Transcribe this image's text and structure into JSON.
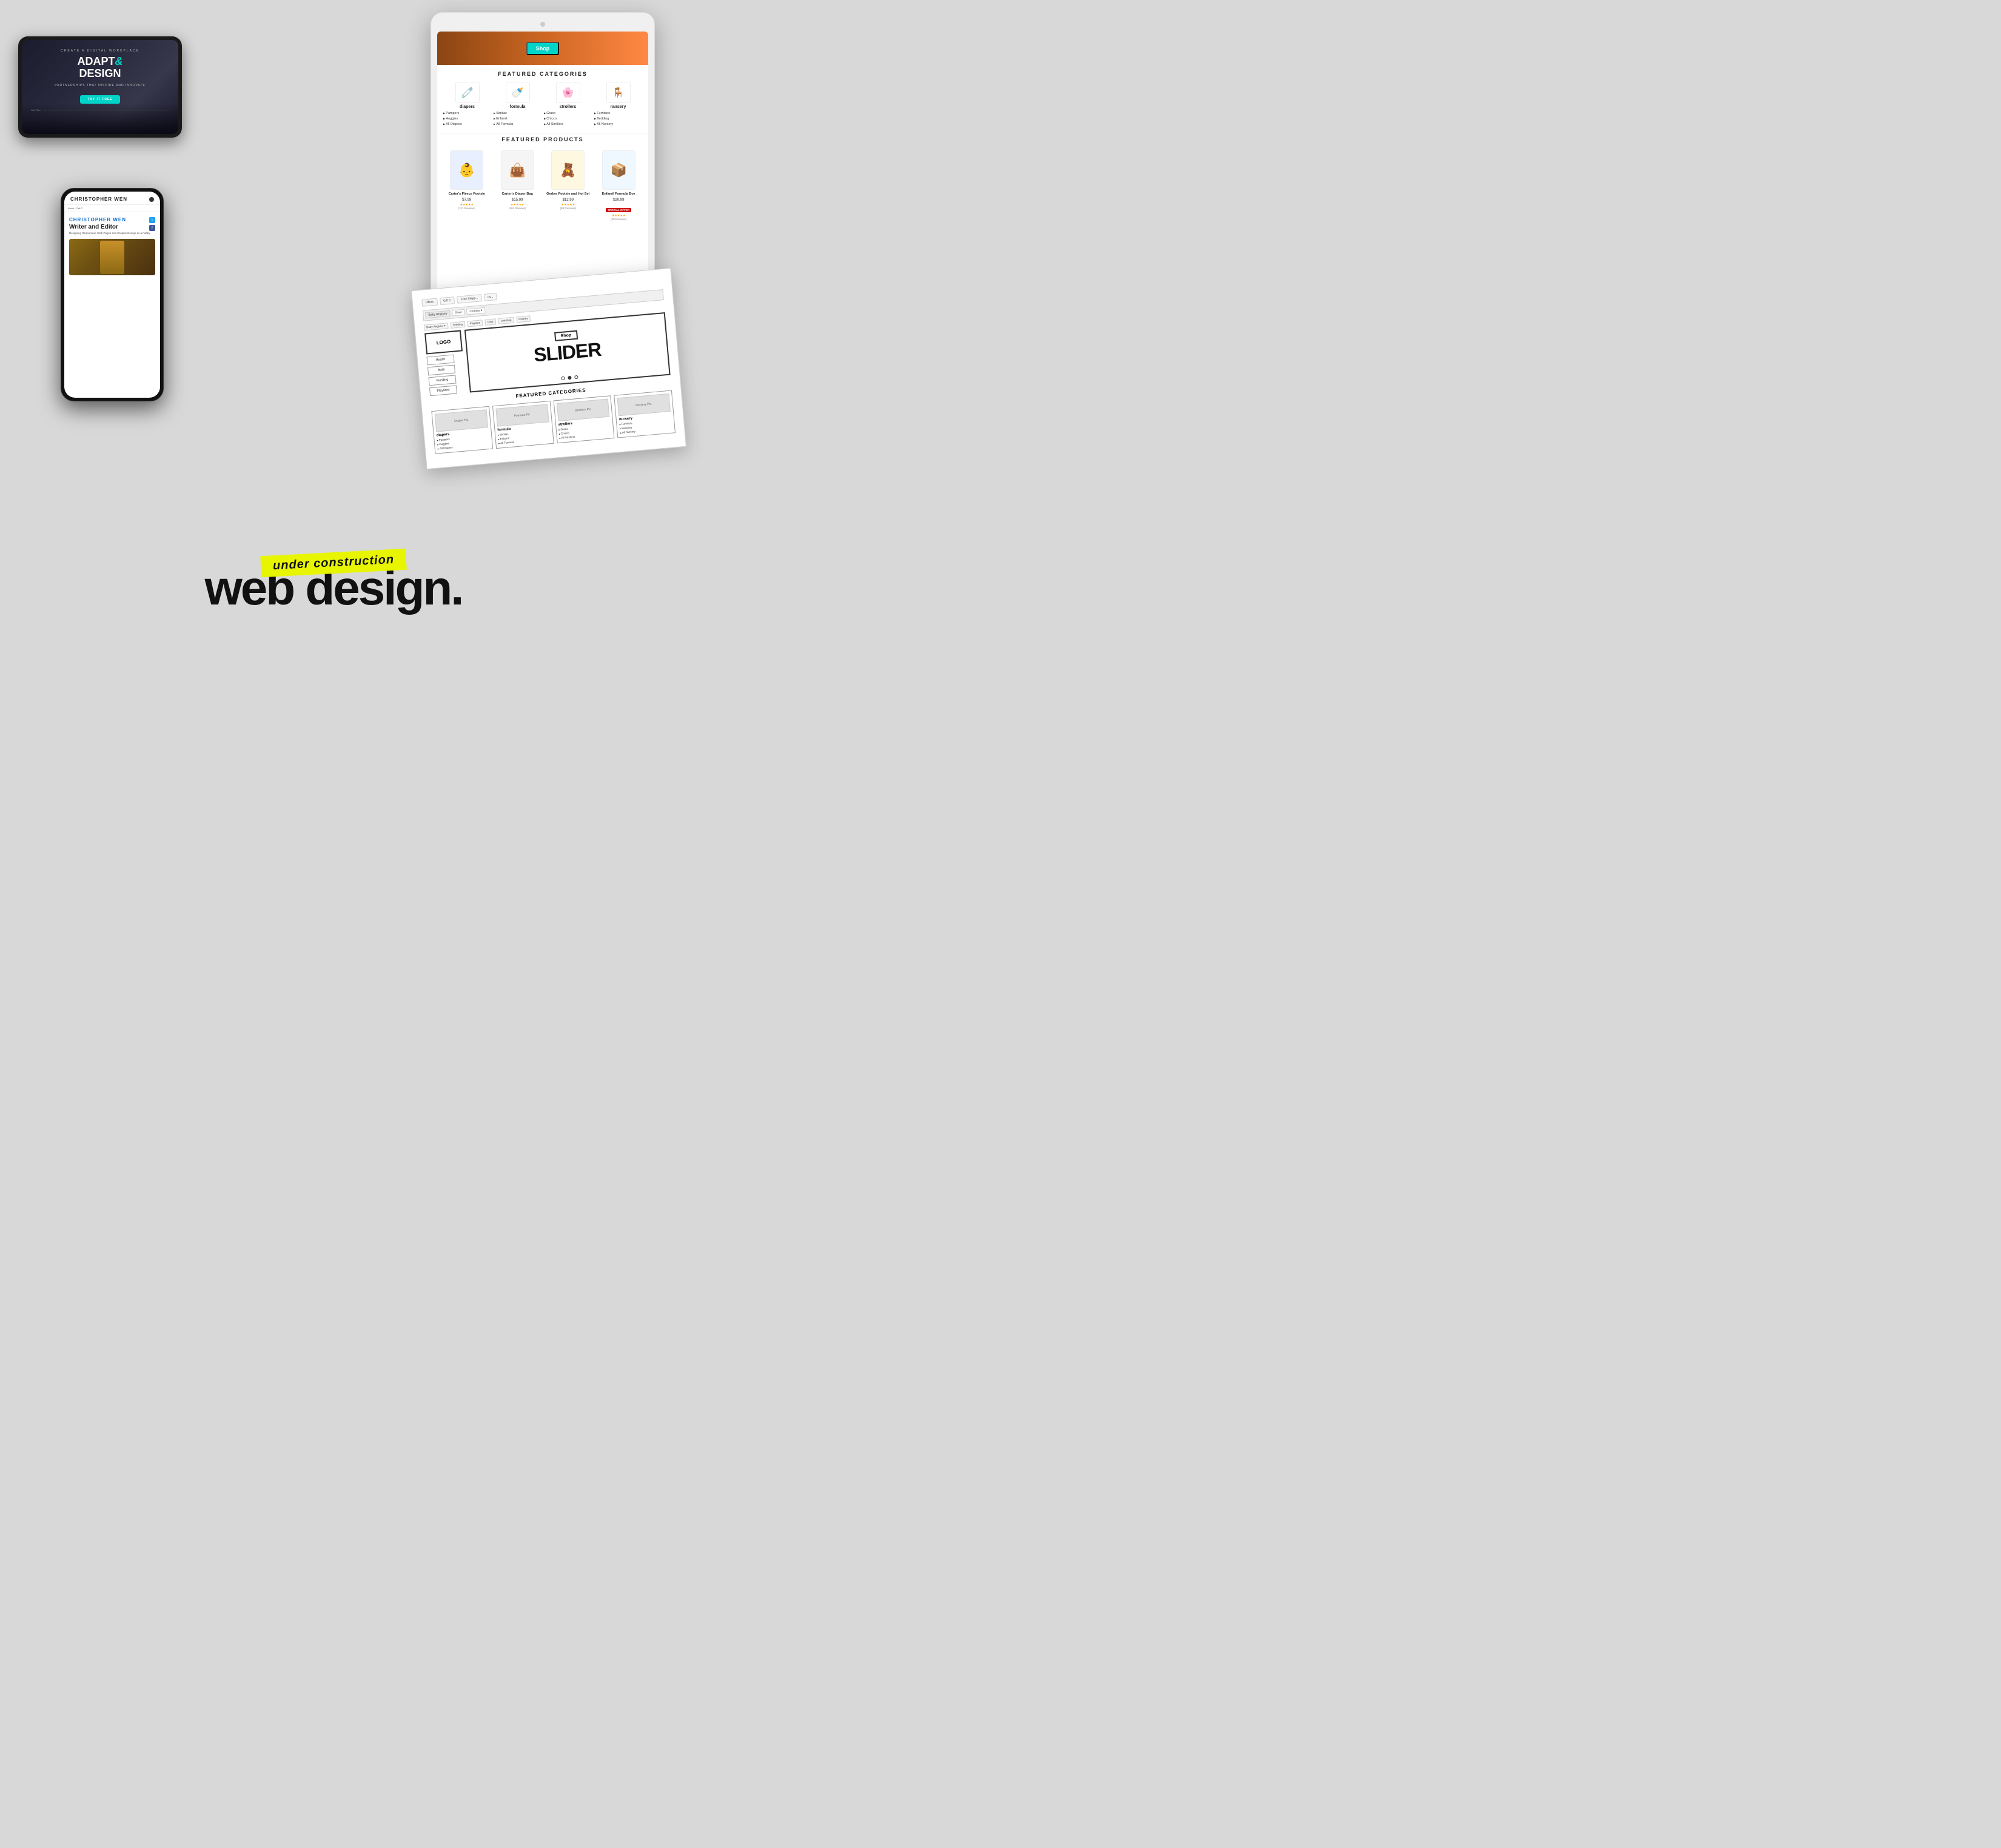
{
  "page": {
    "background": "#d8d8d8"
  },
  "adapt_device": {
    "subtitle": "CREATE A DIGITAL WORKPLACE",
    "title_line1": "ADAPT",
    "title_ampersand": "&",
    "title_line2": "DESIGN",
    "tagline": "PARTNERSHIPS THAT INSPIRE AND INNOVATE",
    "button": "TRY IT FREE",
    "footer_brand": "LiveTiles"
  },
  "christopher_device": {
    "header_name": "Christopher Wen",
    "nav_items": [
      "About",
      "Call C"
    ],
    "name_big": "CHRISTOPHER WEN",
    "title": "Writer and Editor",
    "description": "Designing Responsive Web Pages and Graphic Design as a hobby.",
    "social": [
      "Twitter",
      "Facebook"
    ]
  },
  "tablet": {
    "shop_button": "Shop",
    "featured_categories_title": "FEATURED CATEGORIES",
    "featured_products_title": "FEATURED PRODUCTS",
    "categories": [
      {
        "name": "diapers",
        "icon": "🧷",
        "links": [
          "Pampers",
          "Huggies",
          "All Diapers"
        ]
      },
      {
        "name": "formula",
        "icon": "🍼",
        "links": [
          "Similac",
          "Enfamil",
          "All Formula"
        ]
      },
      {
        "name": "strollers",
        "icon": "🌸",
        "links": [
          "Graco",
          "Chicco",
          "All Strollers"
        ]
      },
      {
        "name": "nursery",
        "icon": "🪑",
        "links": [
          "Furniture",
          "Bedding",
          "All Nursery"
        ]
      }
    ],
    "products": [
      {
        "name": "Carter's Fleece Footsie",
        "price": "$7.99",
        "stars": "★★★★★",
        "reviews": "(131 Reviews)",
        "icon": "👶"
      },
      {
        "name": "Carter's Diaper Bag",
        "price": "$15.99",
        "stars": "★★★★★",
        "reviews": "(265 Reviews)",
        "icon": "👜"
      },
      {
        "name": "Gerber Footsie and Hat Set",
        "price": "$12.99",
        "stars": "★★★★★",
        "reviews": "(88 Reviews)",
        "icon": "🧸"
      },
      {
        "name": "Enfamil Formula Box",
        "price": "$20.99",
        "stars": "★★★★★",
        "reviews": "(99 Reviews)",
        "special": "SPECIAL OFFER",
        "icon": "📦"
      }
    ]
  },
  "wireframe": {
    "top_items": [
      "Offers",
      "Gift C",
      "Free Shipp...",
      "ov..."
    ],
    "nav_items": [
      "Baby Registry",
      "Gear",
      "Clothes ▾"
    ],
    "sub_nav": [
      "Baby Registry ▾",
      "Feeding",
      "Playtime",
      "Gear",
      "Learning",
      "Clothes"
    ],
    "logo": "LOGO",
    "slider": "SLIDER",
    "shop_btn": "Shop",
    "side_nav": [
      "Health",
      "Bath",
      "Feeding",
      "Playtime"
    ],
    "featured_title": "FEATURED CATEGORIES",
    "categories": [
      {
        "pic": "Diaper Pic",
        "name": "diapers",
        "links": [
          "Pampers",
          "Huggies",
          "All Diapers"
        ]
      },
      {
        "pic": "Formula Pic",
        "name": "formula",
        "links": [
          "Similac",
          "Enfamil",
          "All Formula"
        ]
      },
      {
        "pic": "Strollers Pic",
        "name": "strollers",
        "links": [
          "Graco",
          "Chicco",
          "All Strollers"
        ]
      },
      {
        "pic": "Nursery Pic.",
        "name": "nursery",
        "links": [
          "Furniture",
          "Bedding",
          "All Nursery"
        ]
      }
    ]
  },
  "bottom": {
    "badge_text": "under construction",
    "main_text": "web design."
  }
}
